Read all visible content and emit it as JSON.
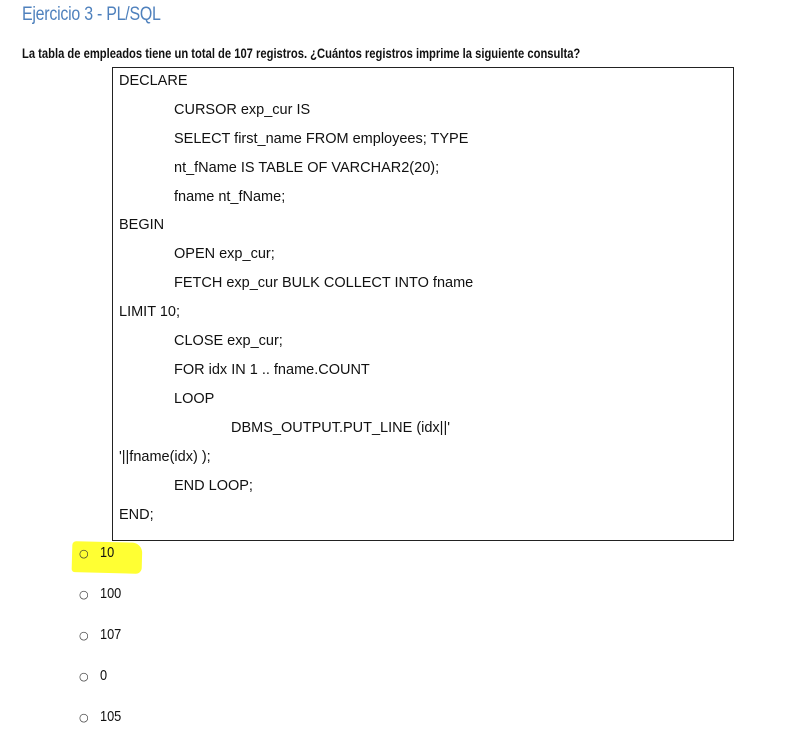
{
  "title": "Ejercicio 3 - PL/SQL",
  "question": "La tabla de empleados tiene un total de 107 registros. ¿Cuántos registros imprime la siguiente consulta?",
  "code": {
    "lines": [
      "DECLARE",
      "CURSOR exp_cur IS",
      "SELECT first_name FROM employees; TYPE",
      "nt_fName IS TABLE OF VARCHAR2(20);",
      "fname nt_fName;",
      "BEGIN",
      "OPEN exp_cur;",
      "FETCH exp_cur BULK COLLECT INTO fname",
      "LIMIT 10;",
      "CLOSE exp_cur;",
      "FOR idx IN 1 .. fname.COUNT",
      "LOOP",
      "DBMS_OUTPUT.PUT_LINE (idx||'",
      "'||fname(idx) );",
      "END LOOP;",
      "END;"
    ]
  },
  "options": [
    {
      "label": "10",
      "highlighted": true
    },
    {
      "label": "100",
      "highlighted": false
    },
    {
      "label": "107",
      "highlighted": false
    },
    {
      "label": "0",
      "highlighted": false
    },
    {
      "label": "105",
      "highlighted": false
    }
  ],
  "colors": {
    "title": "#4f81bd",
    "highlight": "#ffff33"
  },
  "icons": {
    "bullet": "circle-bullet-icon"
  }
}
